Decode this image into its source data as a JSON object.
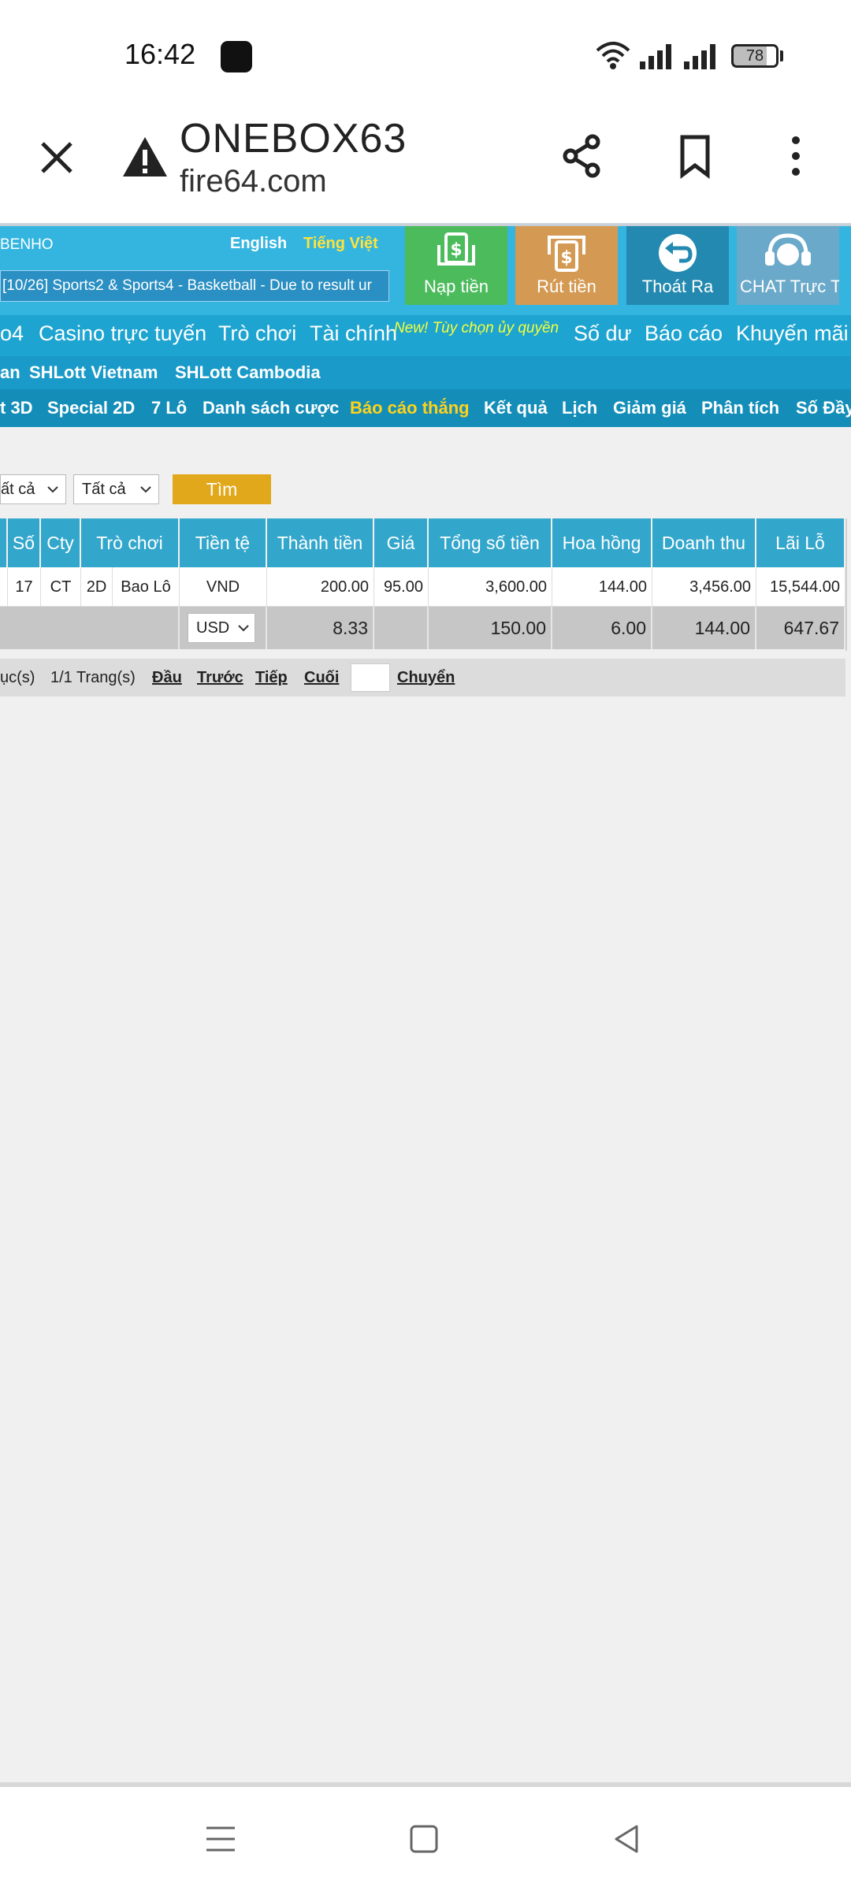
{
  "status_bar": {
    "time": "16:42",
    "battery": "78"
  },
  "browser": {
    "title": "ONEBOX63",
    "url": "fire64.com"
  },
  "header": {
    "site_name": "BENHO",
    "lang_en": "English",
    "lang_vi": "Tiếng Việt",
    "ticker": "[10/26] Sports2 & Sports4 - Basketball - Due to result ur",
    "buttons": {
      "deposit": "Nạp tiền",
      "withdraw": "Rút tiền",
      "logout": "Thoát Ra",
      "chat": "CHAT Trực Tuyến"
    }
  },
  "main_nav": {
    "items": [
      "o4",
      "Casino trực tuyến",
      "Trò chơi",
      "Tài chính",
      "Số dư",
      "Báo cáo",
      "Khuyến mãi"
    ],
    "new_badge": "New! Tùy chọn ủy quyền"
  },
  "sub_nav1": [
    "an",
    "SHLott Vietnam",
    "SHLott Cambodia"
  ],
  "sub_nav2": [
    "t 3D",
    "Special 2D",
    "7 Lô",
    "Danh sách cược",
    "Báo cáo thắng",
    "Kết quả",
    "Lịch",
    "Giảm giá",
    "Phân tích",
    "Số Đầy"
  ],
  "filters": {
    "select1": "ất cả",
    "select2": "Tất cả",
    "search_label": "Tìm"
  },
  "table": {
    "headers": [
      "Số",
      "Cty",
      "Trò chơi",
      "Tiền tệ",
      "Thành tiền",
      "Giá",
      "Tổng số tiền",
      "Hoa hồng",
      "Doanh thu",
      "Lãi Lỗ"
    ],
    "row": {
      "so": "17",
      "cty": "CT",
      "game_type": "2D",
      "game": "Bao Lô",
      "currency": "VND",
      "amount": "200.00",
      "price": "95.00",
      "total": "3,600.00",
      "commission": "144.00",
      "revenue": "3,456.00",
      "profit": "15,544.00"
    },
    "footer": {
      "currency_select": "USD",
      "amount": "8.33",
      "total": "150.00",
      "commission": "6.00",
      "revenue": "144.00",
      "profit": "647.67"
    }
  },
  "pagination": {
    "items_text": "ục(s)",
    "page_text": "1/1 Trang(s)",
    "first": "Đầu",
    "prev": "Trước",
    "next": "Tiếp",
    "last": "Cuối",
    "go": "Chuyển"
  }
}
